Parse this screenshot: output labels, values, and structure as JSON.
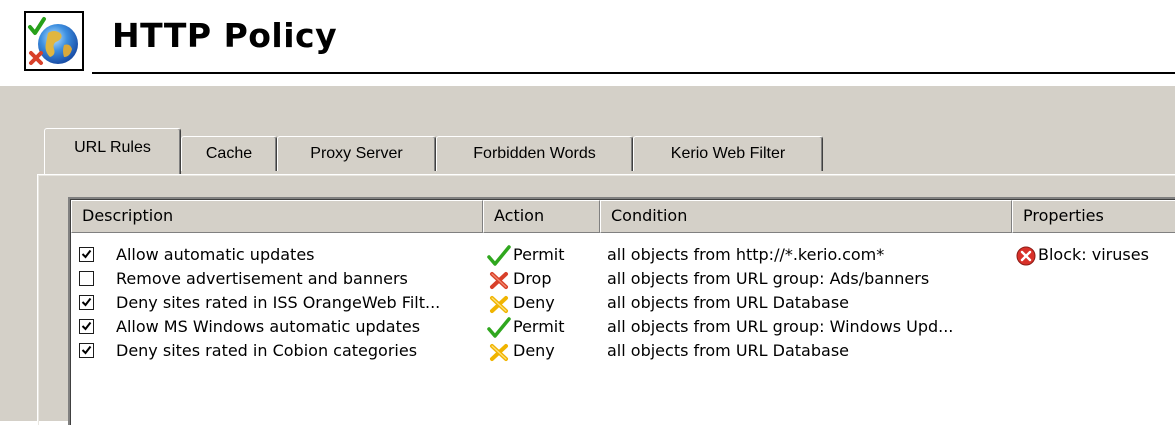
{
  "header": {
    "title": "HTTP Policy",
    "icon": "http-policy-globe-icon"
  },
  "tabs": [
    {
      "label": "URL Rules",
      "active": true
    },
    {
      "label": "Cache",
      "active": false
    },
    {
      "label": "Proxy Server",
      "active": false
    },
    {
      "label": "Forbidden Words",
      "active": false
    },
    {
      "label": "Kerio Web Filter",
      "active": false
    }
  ],
  "table": {
    "columns": [
      "Description",
      "Action",
      "Condition",
      "Properties"
    ],
    "rows": [
      {
        "checked": true,
        "description": "Allow automatic updates",
        "action": "Permit",
        "action_icon": "permit-checkmark-icon",
        "condition": "all objects from http://*.kerio.com*",
        "properties": "Block: viruses",
        "properties_icon": "block-icon"
      },
      {
        "checked": false,
        "description": "Remove advertisement and banners",
        "action": "Drop",
        "action_icon": "drop-icon",
        "condition": "all objects from URL group: Ads/banners",
        "properties": ""
      },
      {
        "checked": true,
        "description": "Deny sites rated in ISS OrangeWeb Filt...",
        "action": "Deny",
        "action_icon": "deny-icon",
        "condition": "all objects from URL Database",
        "properties": ""
      },
      {
        "checked": true,
        "description": "Allow MS Windows automatic updates",
        "action": "Permit",
        "action_icon": "permit-checkmark-icon",
        "condition": "all objects from URL group: Windows Upd...",
        "properties": ""
      },
      {
        "checked": true,
        "description": "Deny sites rated in Cobion categories",
        "action": "Deny",
        "action_icon": "deny-icon",
        "condition": "all objects from URL Database",
        "properties": ""
      }
    ]
  },
  "colors": {
    "dialog_bg": "#d4d0c8",
    "permit_green": "#2fa71e",
    "drop_red": "#d8402a",
    "deny_yellow": "#f0b400",
    "block_red": "#d9312a"
  }
}
